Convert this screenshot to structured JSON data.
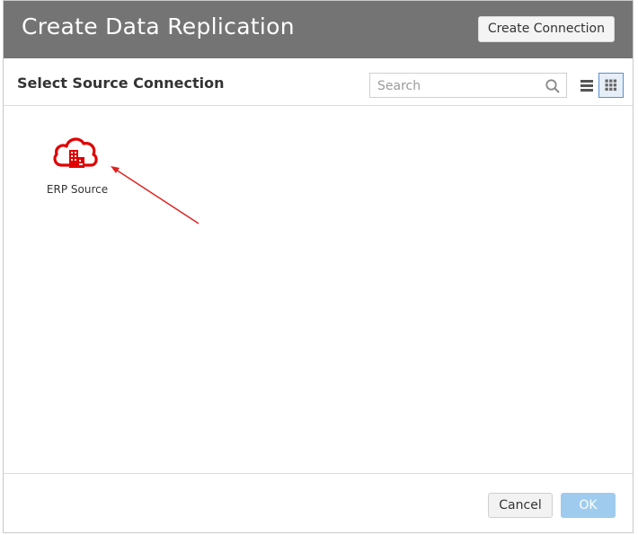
{
  "dialog": {
    "title": "Create Data Replication",
    "create_connection_label": "Create Connection"
  },
  "toolbar": {
    "heading": "Select Source Connection",
    "search_placeholder": "Search",
    "view_modes": [
      "list",
      "grid"
    ],
    "active_view": "grid"
  },
  "connections": [
    {
      "label": "ERP Source",
      "icon": "cloud-building-icon",
      "color": "#e00000"
    }
  ],
  "footer": {
    "cancel_label": "Cancel",
    "ok_label": "OK"
  },
  "colors": {
    "header_bg": "#747474",
    "accent_red": "#e00000",
    "ok_disabled": "#9ecbee"
  }
}
